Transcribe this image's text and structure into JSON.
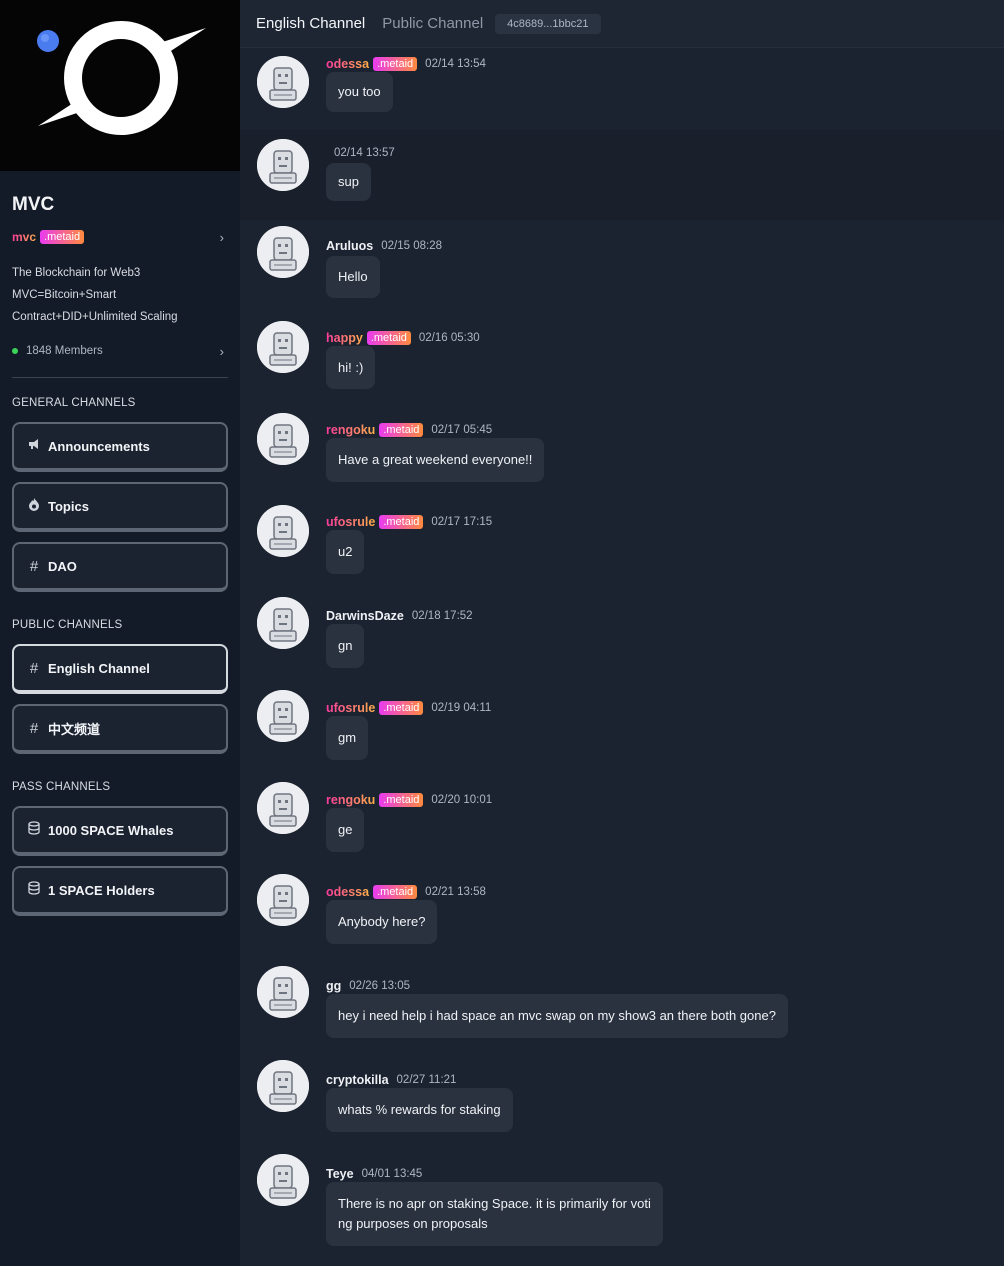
{
  "community": {
    "name": "MVC",
    "owner": "mvc",
    "badge": ".metaid",
    "description": "The Blockchain for Web3 MVC=Bitcoin+Smart Contract+DID+Unlimited Scaling",
    "members": "1848 Members"
  },
  "sections": {
    "general": "GENERAL CHANNELS",
    "public": "PUBLIC CHANNELS",
    "pass": "PASS CHANNELS"
  },
  "channels": {
    "announcements": {
      "label": "Announcements",
      "icon": "megaphone-icon"
    },
    "topics": {
      "label": "Topics",
      "icon": "flame-icon"
    },
    "dao": {
      "label": "DAO",
      "icon": "hash-icon"
    },
    "english": {
      "label": "English Channel",
      "icon": "hash-icon"
    },
    "chinese": {
      "label": "中文频道",
      "icon": "hash-icon"
    },
    "whales": {
      "label": "1000 SPACE Whales",
      "icon": "database-icon"
    },
    "holders": {
      "label": "1 SPACE Holders",
      "icon": "database-icon"
    }
  },
  "header": {
    "active_tab": "English Channel",
    "tab2": "Public Channel",
    "address": "4c8689...1bbc21"
  },
  "messages": [
    {
      "user": "odessa",
      "metaid": true,
      "time": "02/14 13:54",
      "text": "you too"
    },
    {
      "user": "",
      "metaid": false,
      "time": "02/14 13:57",
      "text": "sup"
    },
    {
      "user": "Aruluos",
      "metaid": false,
      "time": "02/15 08:28",
      "text": "Hello"
    },
    {
      "user": "happy",
      "metaid": true,
      "time": "02/16 05:30",
      "text": "hi! :)"
    },
    {
      "user": "rengoku",
      "metaid": true,
      "time": "02/17 05:45",
      "text": "Have a great weekend everyone!!"
    },
    {
      "user": "ufosrule",
      "metaid": true,
      "time": "02/17 17:15",
      "text": "u2"
    },
    {
      "user": "DarwinsDaze",
      "metaid": false,
      "time": "02/18 17:52",
      "text": "gn"
    },
    {
      "user": "ufosrule",
      "metaid": true,
      "time": "02/19 04:11",
      "text": "gm"
    },
    {
      "user": "rengoku",
      "metaid": true,
      "time": "02/20 10:01",
      "text": "ge"
    },
    {
      "user": "odessa",
      "metaid": true,
      "time": "02/21 13:58",
      "text": "Anybody here?"
    },
    {
      "user": "gg",
      "metaid": false,
      "time": "02/26 13:05",
      "text": "hey i need help i had space an mvc swap on my show3 an there both gone?"
    },
    {
      "user": "cryptokilla",
      "metaid": false,
      "time": "02/27 11:21",
      "text": "whats % rewards for staking"
    },
    {
      "user": "Teye",
      "metaid": false,
      "time": "04/01 13:45",
      "text": "There is no apr on staking Space. it is primarily for voti\nng purposes on proposals"
    }
  ]
}
